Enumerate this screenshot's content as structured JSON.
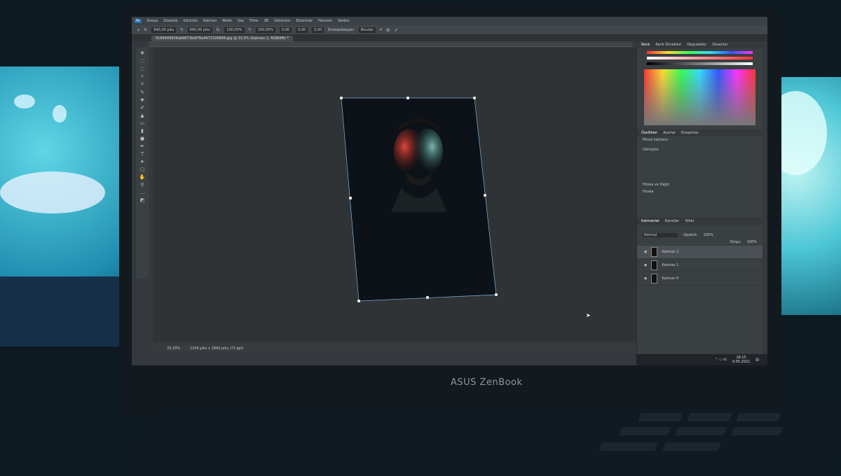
{
  "menu": [
    "Dosya",
    "Düzenle",
    "Görüntü",
    "Katman",
    "Metin",
    "Seç",
    "Filtre",
    "3B",
    "Görünüm",
    "Eklentiler",
    "Pencere",
    "Yardım"
  ],
  "ps_badge": "Ps",
  "options": {
    "x_label": "X:",
    "x": "640,00 piks",
    "y_label": "Y:",
    "y": "940,00 piks",
    "w_label": "G:",
    "w": "100,00%",
    "h_label": "Y:",
    "h": "100,00%",
    "angle": "0,00",
    "hskew": "0,00",
    "vskew": "0,00",
    "interp_label": "Enterpolasyon:",
    "interp": "Bicubic"
  },
  "tab": "0189645656ab6673fe976a4473326894.jpg @ 33,3% (Katman 2, RGB/8#) *",
  "status": {
    "zoom": "33,33%",
    "size": "1200 piks x 1800 piks (72 ppi)"
  },
  "color_panel": {
    "tabs": [
      "Renk",
      "Renk Örnekleri",
      "Degradeler",
      "Desenler"
    ]
  },
  "props_panel": {
    "tabs": [
      "Özellikler",
      "Ayarlar",
      "Kitaplıklar"
    ],
    "type": "Piksel katmanı",
    "transform": "Dönüştür",
    "align": "Hizala ve Dağıt",
    "align_sub": "Hizala"
  },
  "layers_panel": {
    "tabs": [
      "Katmanlar",
      "Kanallar",
      "Yollar"
    ],
    "blend": "Normal",
    "opacity_label": "Opaklık:",
    "opacity": "100%",
    "fill_label": "Dolgu:",
    "fill": "100%",
    "layers": [
      "Katman 2",
      "Katman 1",
      "Katman 0"
    ]
  },
  "taskbar": {
    "time": "18:15",
    "date": "9.05.2021"
  },
  "brand": "ASUS ZenBook"
}
